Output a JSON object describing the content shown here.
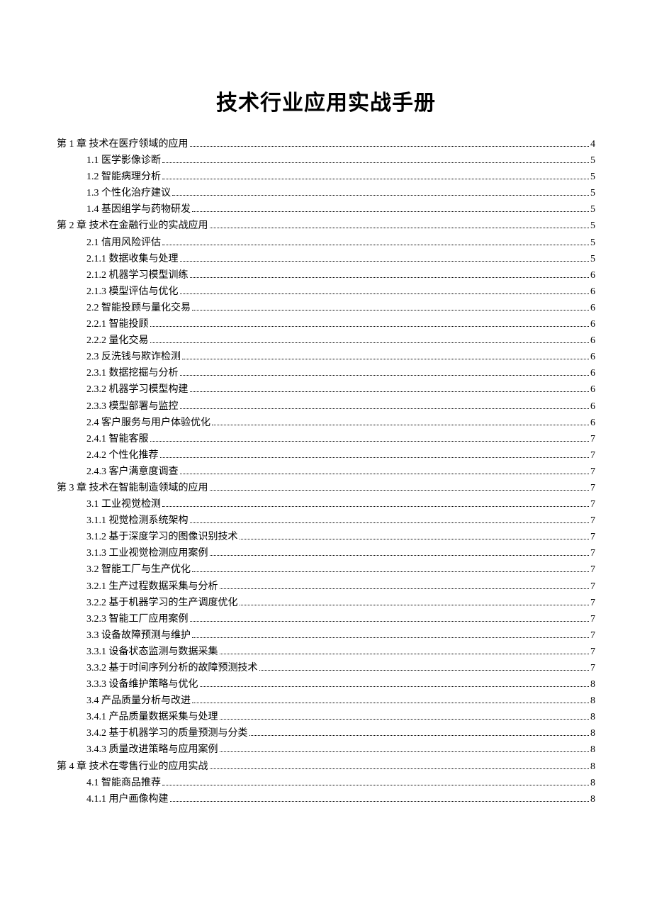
{
  "title": "技术行业应用实战手册",
  "toc": [
    {
      "level": 0,
      "label": "第 1 章 技术在医疗领域的应用",
      "page": "4"
    },
    {
      "level": 1,
      "label": "1.1 医学影像诊断",
      "page": "5"
    },
    {
      "level": 1,
      "label": "1.2 智能病理分析",
      "page": "5"
    },
    {
      "level": 1,
      "label": "1.3 个性化治疗建议",
      "page": "5"
    },
    {
      "level": 1,
      "label": "1.4 基因组学与药物研发",
      "page": "5"
    },
    {
      "level": 0,
      "label": "第 2 章 技术在金融行业的实战应用",
      "page": "5"
    },
    {
      "level": 1,
      "label": "2.1 信用风险评估",
      "page": "5"
    },
    {
      "level": 1,
      "label": "2.1.1 数据收集与处理",
      "page": "5"
    },
    {
      "level": 1,
      "label": "2.1.2 机器学习模型训练",
      "page": "6"
    },
    {
      "level": 1,
      "label": "2.1.3 模型评估与优化",
      "page": "6"
    },
    {
      "level": 1,
      "label": "2.2 智能投顾与量化交易",
      "page": "6"
    },
    {
      "level": 1,
      "label": "2.2.1 智能投顾",
      "page": "6"
    },
    {
      "level": 1,
      "label": "2.2.2 量化交易",
      "page": "6"
    },
    {
      "level": 1,
      "label": "2.3 反洗钱与欺诈检测",
      "page": "6"
    },
    {
      "level": 1,
      "label": "2.3.1 数据挖掘与分析",
      "page": "6"
    },
    {
      "level": 1,
      "label": "2.3.2 机器学习模型构建",
      "page": "6"
    },
    {
      "level": 1,
      "label": "2.3.3 模型部署与监控",
      "page": "6"
    },
    {
      "level": 1,
      "label": "2.4 客户服务与用户体验优化",
      "page": "6"
    },
    {
      "level": 1,
      "label": "2.4.1 智能客服",
      "page": "7"
    },
    {
      "level": 1,
      "label": "2.4.2 个性化推荐",
      "page": "7"
    },
    {
      "level": 1,
      "label": "2.4.3 客户满意度调查",
      "page": "7"
    },
    {
      "level": 0,
      "label": "第 3 章 技术在智能制造领域的应用",
      "page": "7"
    },
    {
      "level": 1,
      "label": "3.1 工业视觉检测",
      "page": "7"
    },
    {
      "level": 1,
      "label": "3.1.1 视觉检测系统架构",
      "page": "7"
    },
    {
      "level": 1,
      "label": "3.1.2 基于深度学习的图像识别技术",
      "page": "7"
    },
    {
      "level": 1,
      "label": "3.1.3 工业视觉检测应用案例",
      "page": "7"
    },
    {
      "level": 1,
      "label": "3.2 智能工厂与生产优化",
      "page": "7"
    },
    {
      "level": 1,
      "label": "3.2.1 生产过程数据采集与分析",
      "page": "7"
    },
    {
      "level": 1,
      "label": "3.2.2 基于机器学习的生产调度优化",
      "page": "7"
    },
    {
      "level": 1,
      "label": "3.2.3 智能工厂应用案例",
      "page": "7"
    },
    {
      "level": 1,
      "label": "3.3 设备故障预测与维护",
      "page": "7"
    },
    {
      "level": 1,
      "label": "3.3.1 设备状态监测与数据采集",
      "page": "7"
    },
    {
      "level": 1,
      "label": "3.3.2 基于时间序列分析的故障预测技术",
      "page": "7"
    },
    {
      "level": 1,
      "label": "3.3.3 设备维护策略与优化",
      "page": "8"
    },
    {
      "level": 1,
      "label": "3.4 产品质量分析与改进",
      "page": "8"
    },
    {
      "level": 1,
      "label": "3.4.1 产品质量数据采集与处理",
      "page": "8"
    },
    {
      "level": 1,
      "label": "3.4.2 基于机器学习的质量预测与分类",
      "page": "8"
    },
    {
      "level": 1,
      "label": "3.4.3 质量改进策略与应用案例",
      "page": "8"
    },
    {
      "level": 0,
      "label": "第 4 章 技术在零售行业的应用实战",
      "page": "8"
    },
    {
      "level": 1,
      "label": "4.1 智能商品推荐",
      "page": "8"
    },
    {
      "level": 1,
      "label": "4.1.1 用户画像构建",
      "page": "8"
    }
  ]
}
